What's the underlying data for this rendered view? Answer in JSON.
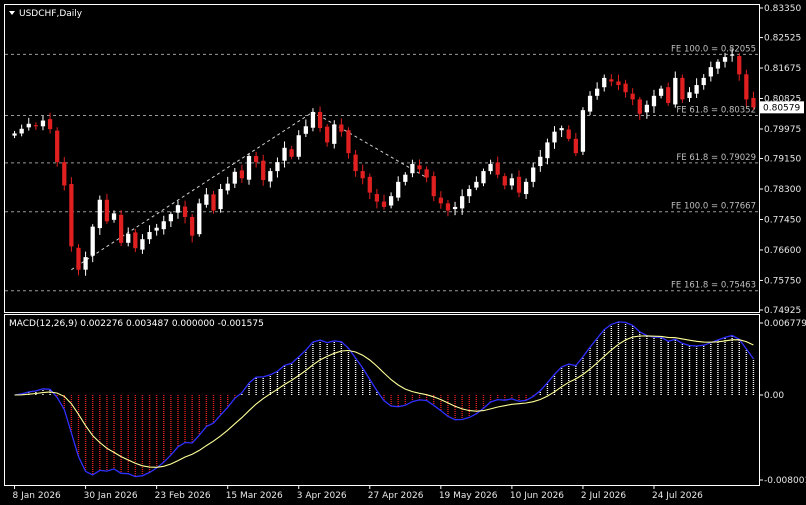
{
  "window": {
    "symbol_title": "USDCHF,Daily"
  },
  "colors": {
    "bull": "#ffffff",
    "bear": "#e02020",
    "grid_dash": "#9a9a9a",
    "macd_line": "#3030ff",
    "signal_line": "#ffff99",
    "hist_pos": "#ffffff",
    "hist_neg": "#e02020",
    "price_box": "#ffffff"
  },
  "chart_data": [
    {
      "type": "candlestick",
      "title": "USDCHF,Daily",
      "y_ticks": [
        "0.83350",
        "0.82525",
        "0.81675",
        "0.80825",
        "0.79975",
        "0.79150",
        "0.78300",
        "0.77450",
        "0.76600",
        "0.75750",
        "0.74925"
      ],
      "y_tick_values": [
        0.8335,
        0.82525,
        0.81675,
        0.80825,
        0.79975,
        0.7915,
        0.783,
        0.7745,
        0.766,
        0.7575,
        0.74925
      ],
      "ylim": [
        0.74925,
        0.8335
      ],
      "current_price": "0.80579",
      "current_price_value": 0.80579,
      "fibonacci_levels": [
        {
          "label": "FE 100.0 = 0.82055",
          "value": 0.82055
        },
        {
          "label": "FE 61.8 = 0.80352",
          "value": 0.80352
        },
        {
          "label": "FE 61.8 = 0.79029",
          "value": 0.79029
        },
        {
          "label": "FE 100.0 = 0.77667",
          "value": 0.77667
        },
        {
          "label": "FE 161.8 = 0.75463",
          "value": 0.75463
        }
      ],
      "trend_lines": [
        {
          "from_index": 8,
          "from_value": 0.7605,
          "to_index": 42,
          "to_value": 0.8045
        },
        {
          "from_index": 42,
          "from_value": 0.8045,
          "to_index": 58,
          "to_value": 0.7862
        }
      ],
      "x_ticks": [
        "8 Jan 2026",
        "30 Jan 2026",
        "23 Feb 2026",
        "15 Mar 2026",
        "3 Apr 2026",
        "27 Apr 2026",
        "19 May 2026",
        "10 Jun 2026",
        "2 Jul 2026",
        "24 Jul 2026"
      ],
      "x_tick_indices": [
        0,
        10,
        20,
        30,
        40,
        50,
        60,
        70,
        80,
        90
      ],
      "closes": [
        0.7985,
        0.7998,
        0.8012,
        0.8005,
        0.8021,
        0.7997,
        0.7905,
        0.784,
        0.767,
        0.7605,
        0.764,
        0.7725,
        0.78,
        0.774,
        0.7762,
        0.768,
        0.7705,
        0.7665,
        0.769,
        0.771,
        0.7722,
        0.774,
        0.776,
        0.7785,
        0.7752,
        0.77,
        0.779,
        0.7815,
        0.777,
        0.783,
        0.7845,
        0.7878,
        0.786,
        0.7922,
        0.7905,
        0.7855,
        0.788,
        0.7905,
        0.7945,
        0.792,
        0.798,
        0.8005,
        0.8045,
        0.8,
        0.796,
        0.801,
        0.799,
        0.793,
        0.788,
        0.786,
        0.782,
        0.7795,
        0.778,
        0.781,
        0.785,
        0.787,
        0.79,
        0.7885,
        0.7862,
        0.781,
        0.779,
        0.777,
        0.778,
        0.781,
        0.783,
        0.785,
        0.788,
        0.79,
        0.787,
        0.784,
        0.786,
        0.782,
        0.785,
        0.789,
        0.792,
        0.796,
        0.799,
        0.8,
        0.797,
        0.793,
        0.805,
        0.809,
        0.811,
        0.814,
        0.813,
        0.812,
        0.81,
        0.808,
        0.804,
        0.8065,
        0.809,
        0.811,
        0.807,
        0.814,
        0.808,
        0.81,
        0.812,
        0.814,
        0.817,
        0.8185,
        0.8198,
        0.8205,
        0.815,
        0.808,
        0.8058
      ]
    },
    {
      "type": "macd",
      "title": "MACD(12,26,9) 0.002276 0.003487 0.000000 -0.001575",
      "y_ticks": [
        "0.006779",
        "0.00",
        "-0.008001"
      ],
      "y_tick_values": [
        0.006779,
        0.0,
        -0.008001
      ],
      "ylim": [
        -0.008001,
        0.006779
      ]
    }
  ]
}
